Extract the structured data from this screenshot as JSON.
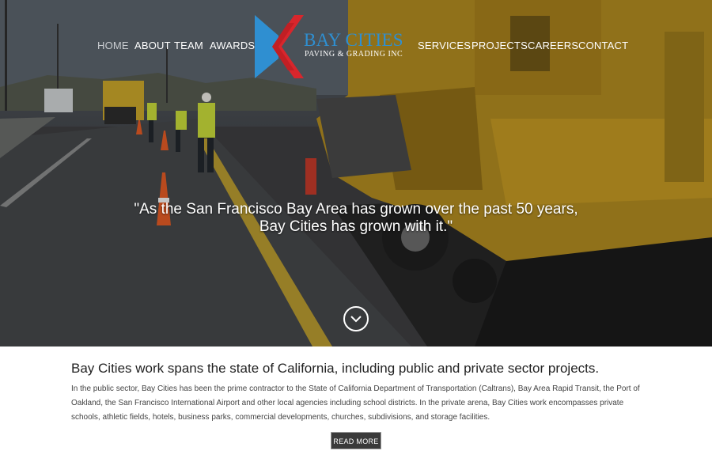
{
  "nav": {
    "left": [
      "HOME",
      "ABOUT",
      "TEAM",
      "AWARDS"
    ],
    "right": [
      "SERVICES",
      "PROJECTS",
      "CAREERS",
      "CONTACT"
    ],
    "active": "HOME"
  },
  "logo": {
    "name": "BAY CITIES",
    "tagline": "PAVING & GRADING INC",
    "colors": {
      "blue": "#2f8fd1",
      "red": "#d8262c"
    }
  },
  "hero": {
    "quote_line1": "\"As the San Francisco Bay Area has grown over the past 50 years,",
    "quote_line2": "Bay Cities has grown with it.\"",
    "scroll_icon": "chevron-down-circle-icon"
  },
  "content": {
    "heading": "Bay Cities work spans the state of California, including public and private sector projects.",
    "body": "In the public sector, Bay Cities has been the prime contractor to the State of California Department of Transportation (Caltrans), Bay Area Rapid Transit, the Port of Oakland, the San Francisco International Airport and other local agencies including school districts. In the private arena, Bay Cities work encompasses private schools, athletic fields, hotels, business parks, commercial developments, churches, subdivisions, and storage facilities.",
    "button": "READ MORE"
  }
}
